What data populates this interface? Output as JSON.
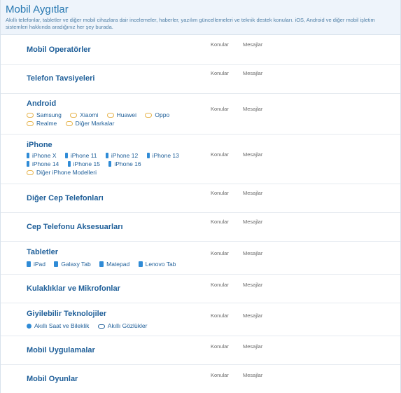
{
  "category": {
    "title": "Mobil Aygıtlar",
    "description": "Akıllı telefonlar, tabletler ve diğer mobil cihazlara dair incelemeler, haberler, yazılım güncellemeleri ve teknik destek konuları. iOS, Android ve diğer mobil işletim sistemleri hakkında aradığınız her şey burada."
  },
  "stats": {
    "topics_label": "Konular",
    "posts_label": "Mesajlar"
  },
  "nodes": [
    {
      "title": "Mobil Operatörler"
    },
    {
      "title": "Telefon Tavsiyeleri"
    },
    {
      "title": "Android",
      "subs": [
        [
          "Samsung",
          "Xiaomi",
          "Huawei",
          "Oppo"
        ],
        [
          "Realme",
          "Diğer Markalar"
        ]
      ]
    },
    {
      "title": "iPhone",
      "subs": [
        [
          "iPhone X",
          "iPhone 11",
          "iPhone 12",
          "iPhone 13"
        ],
        [
          "iPhone 14",
          "iPhone 15",
          "iPhone 16"
        ],
        [
          "Diğer iPhone Modelleri"
        ]
      ]
    },
    {
      "title": "Diğer Cep Telefonları"
    },
    {
      "title": "Cep Telefonu Aksesuarları"
    },
    {
      "title": "Tabletler",
      "subs": [
        [
          "iPad",
          "Galaxy Tab",
          "Matepad",
          "Lenovo Tab"
        ]
      ]
    },
    {
      "title": "Kulaklıklar ve Mikrofonlar"
    },
    {
      "title": "Giyilebilir Teknolojiler",
      "subs": [
        [
          "Akıllı Saat ve Bileklik",
          "Akıllı Gözlükler"
        ]
      ]
    },
    {
      "title": "Mobil Uygulamalar"
    },
    {
      "title": "Mobil Oyunlar"
    }
  ],
  "icons": {
    "android_subs": "chat-bubble-icon",
    "iphone_subs": "phone-icon",
    "tablet_subs": "tablet-icon",
    "watch": "smartwatch-icon",
    "glasses": "glasses-icon"
  },
  "colors": {
    "link": "#1f5f99",
    "header_bg": "#eef4fb",
    "title": "#2577b1",
    "icon_blue": "#2f8bd6",
    "icon_orange": "#e6b34a"
  }
}
